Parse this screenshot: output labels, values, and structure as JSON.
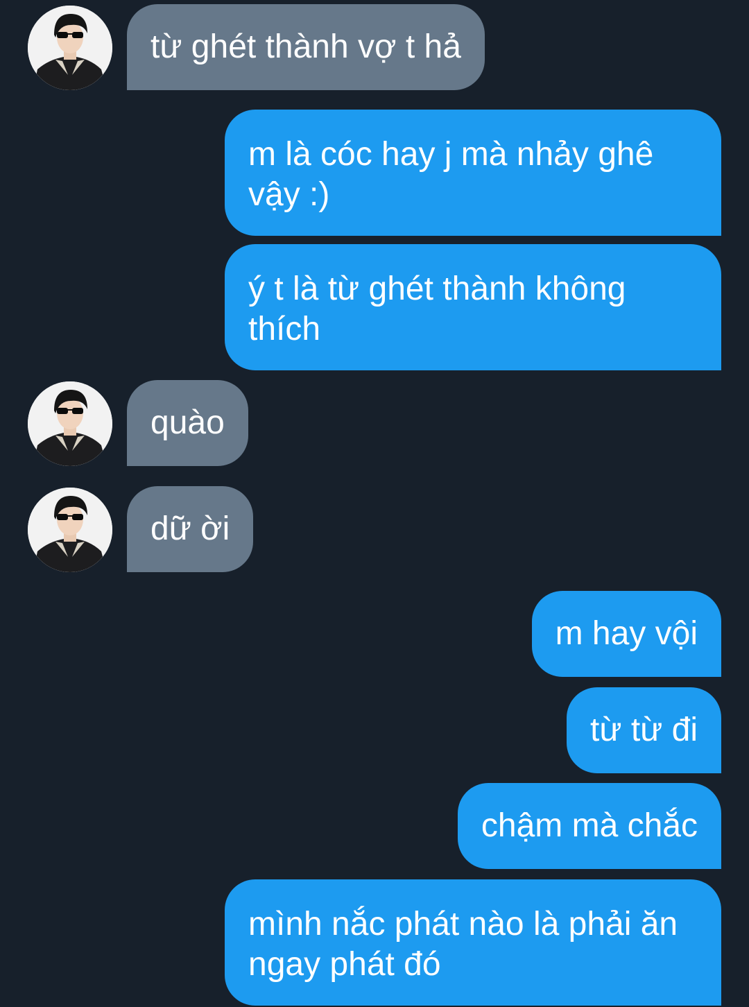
{
  "conversation": {
    "contact": {
      "avatar_icon": "profile-photo-man-sunglasses-icon"
    },
    "messages": [
      {
        "side": "in",
        "text": "từ ghét thành vợ t hả",
        "has_avatar": true
      },
      {
        "side": "out",
        "text": "m là cóc hay j mà nhảy ghê\nvậy :)"
      },
      {
        "side": "out",
        "text": "ý t là từ ghét thành không\nthích"
      },
      {
        "side": "in",
        "text": "quào",
        "has_avatar": true
      },
      {
        "side": "in",
        "text": "dữ ời",
        "has_avatar": true
      },
      {
        "side": "out",
        "text": "m hay vội"
      },
      {
        "side": "out",
        "text": "từ từ đi"
      },
      {
        "side": "out",
        "text": "chậm mà chắc"
      },
      {
        "side": "out",
        "text": "mình nắc phát nào là phải ăn\nngay phát đó"
      }
    ]
  },
  "colors": {
    "background": "#17202b",
    "incoming_bubble": "#66788a",
    "outgoing_bubble": "#1d9bf0",
    "text": "#ffffff"
  }
}
